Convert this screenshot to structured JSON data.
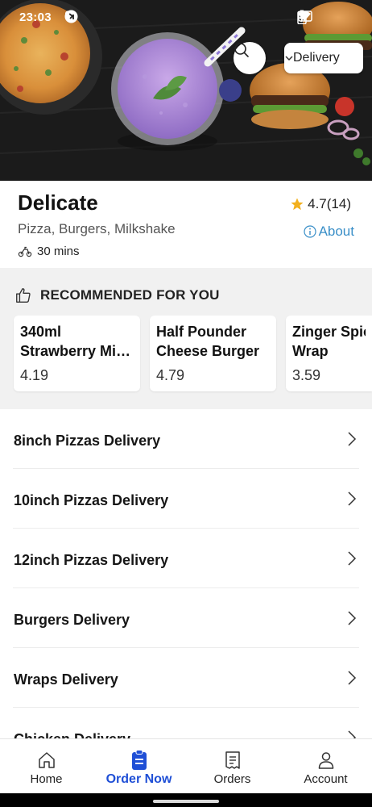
{
  "status_bar": {
    "time": "23:03",
    "left_icons": [
      "s-icon",
      "info-icon",
      "s-icon",
      "shazam-icon",
      "dot-icon"
    ],
    "right_icons": [
      "cast-icon",
      "wifi-icon",
      "battery-charging-icon"
    ]
  },
  "header": {
    "order_type": "Delivery",
    "search_icon": "search-icon"
  },
  "restaurant": {
    "name": "Delicate",
    "rating": "4.7(14)",
    "cuisines": "Pizza, Burgers, Milkshake",
    "about_label": "About",
    "delivery_time": "30 mins",
    "accent_color": "#3a8fc8",
    "star_color": "#f2b01e"
  },
  "recommended": {
    "title": "RECOMMENDED FOR YOU",
    "items": [
      {
        "name_line1": "340ml",
        "name_line2": "Strawberry Mi…",
        "price": "4.19"
      },
      {
        "name_line1": "Half Pounder",
        "name_line2": "Cheese Burger",
        "price": "4.79"
      },
      {
        "name_line1": "Zinger Spicy",
        "name_line2": "Wrap",
        "price": "3.59"
      }
    ]
  },
  "categories": [
    "8inch Pizzas Delivery",
    "10inch Pizzas Delivery",
    "12inch Pizzas Delivery",
    "Burgers Delivery",
    "Wraps Delivery",
    "Chicken Delivery"
  ],
  "bottom_nav": {
    "items": [
      {
        "label": "Home",
        "icon": "home-icon"
      },
      {
        "label": "Order Now",
        "icon": "order-now-icon"
      },
      {
        "label": "Orders",
        "icon": "receipt-icon"
      },
      {
        "label": "Account",
        "icon": "account-icon"
      }
    ],
    "active_index": 1,
    "active_color": "#1f4fd6"
  }
}
